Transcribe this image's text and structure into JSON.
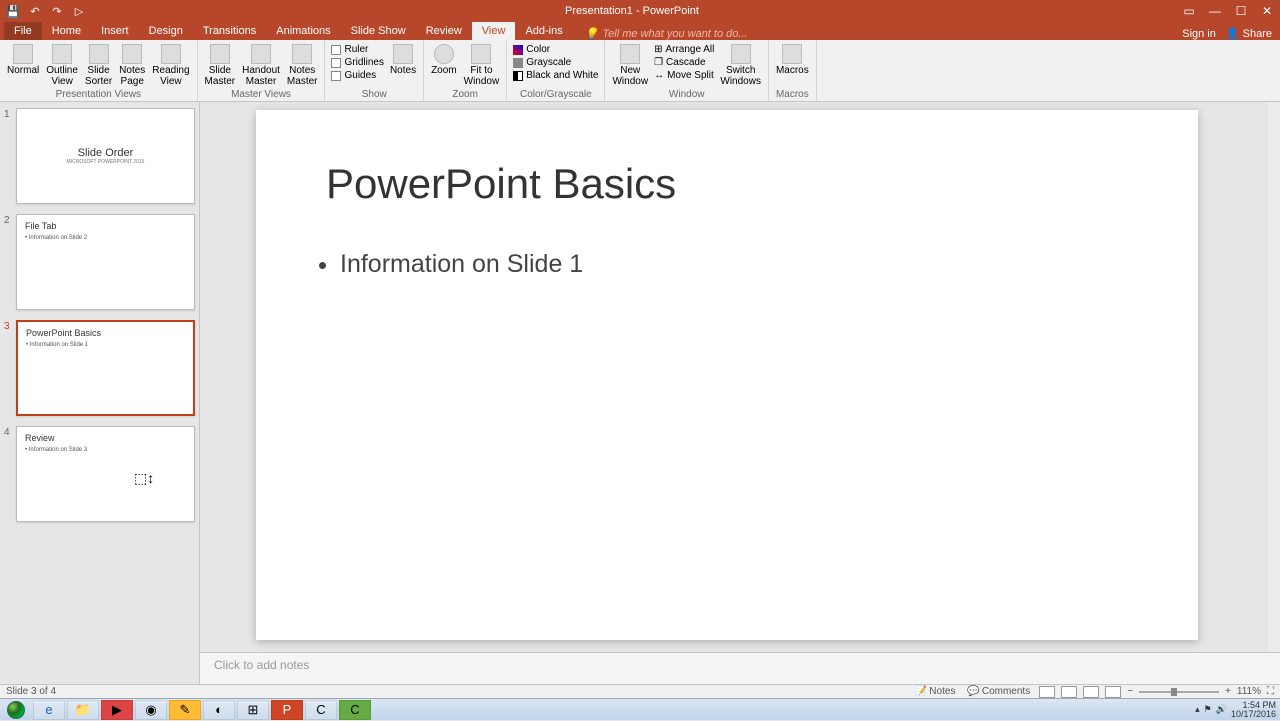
{
  "title": "Presentation1 - PowerPoint",
  "qat": {
    "save": "💾",
    "undo": "↶",
    "redo": "↷",
    "start": "▷"
  },
  "win": {
    "opts": "▭",
    "min": "—",
    "max": "☐",
    "close": "✕"
  },
  "tabs": {
    "file": "File",
    "home": "Home",
    "insert": "Insert",
    "design": "Design",
    "transitions": "Transitions",
    "animations": "Animations",
    "slideshow": "Slide Show",
    "review": "Review",
    "view": "View",
    "addins": "Add-ins",
    "tellme": "Tell me what you want to do...",
    "signin": "Sign in",
    "share": "Share"
  },
  "ribbon": {
    "presentation_views": {
      "label": "Presentation Views",
      "normal": "Normal",
      "outline": "Outline\nView",
      "sorter": "Slide\nSorter",
      "notespage": "Notes\nPage",
      "reading": "Reading\nView"
    },
    "master_views": {
      "label": "Master Views",
      "slide": "Slide\nMaster",
      "handout": "Handout\nMaster",
      "notes": "Notes\nMaster"
    },
    "show": {
      "label": "Show",
      "ruler": "Ruler",
      "gridlines": "Gridlines",
      "guides": "Guides",
      "notes": "Notes"
    },
    "zoom": {
      "label": "Zoom",
      "zoom": "Zoom",
      "fit": "Fit to\nWindow"
    },
    "color": {
      "label": "Color/Grayscale",
      "color": "Color",
      "grayscale": "Grayscale",
      "bw": "Black and White"
    },
    "window": {
      "label": "Window",
      "new": "New\nWindow",
      "arrange": "Arrange All",
      "cascade": "Cascade",
      "movesplit": "Move Split",
      "switch": "Switch\nWindows"
    },
    "macros": {
      "label": "Macros",
      "macros": "Macros"
    }
  },
  "slides": [
    {
      "num": "1",
      "title": "Slide Order",
      "sub": "MICROSOFT POWERPOINT 2016",
      "layout": "title"
    },
    {
      "num": "2",
      "title": "File Tab",
      "body": "• Information on Slide 2",
      "layout": "content"
    },
    {
      "num": "3",
      "title": "PowerPoint Basics",
      "body": "• Information on Slide 1",
      "layout": "content",
      "selected": true
    },
    {
      "num": "4",
      "title": "Review",
      "body": "• Information on Slide 3",
      "layout": "content"
    }
  ],
  "main_slide": {
    "title": "PowerPoint Basics",
    "bullet": "Information on Slide 1"
  },
  "notes_placeholder": "Click to add notes",
  "status": {
    "left": "Slide 3 of 4",
    "notes": "Notes",
    "comments": "Comments",
    "zoom_pct": "111%"
  },
  "tray": {
    "time": "1:54 PM",
    "date": "10/17/2016"
  }
}
